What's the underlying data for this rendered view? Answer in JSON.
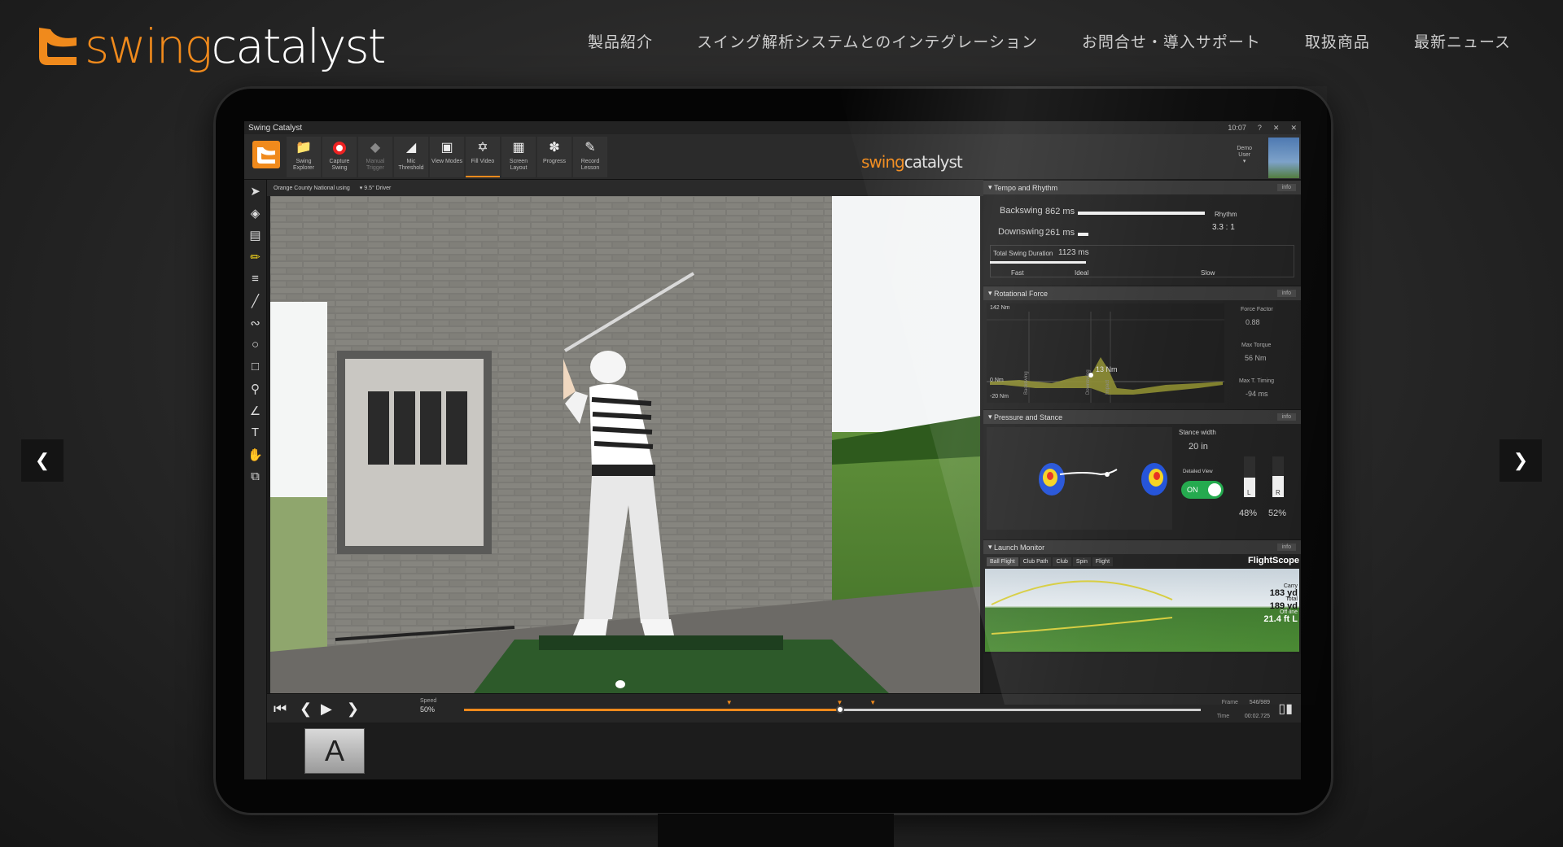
{
  "site": {
    "brand_prefix": "swing",
    "brand_suffix": "catalyst",
    "nav": [
      "製品紹介",
      "スイング解析システムとのインテグレーション",
      "お問合せ・導入サポート",
      "取扱商品",
      "最新ニュース"
    ],
    "prev_icon": "chevron-left-icon",
    "next_icon": "chevron-right-icon"
  },
  "app": {
    "window_title": "Swing Catalyst",
    "clock": "10:07",
    "window_buttons": [
      "?",
      "✕",
      "✕"
    ],
    "center_logo_prefix": "swing",
    "center_logo_suffix": "catalyst",
    "user_label_1": "Demo",
    "user_label_2": "User",
    "tools": [
      {
        "label": "Swing Explorer",
        "icon": "folder-icon"
      },
      {
        "label": "Capture Swing",
        "icon": "record-icon"
      },
      {
        "label": "Manual Trigger",
        "icon": "trigger-icon"
      },
      {
        "label": "Mic Threshold",
        "icon": "threshold-icon"
      },
      {
        "label": "View Modes",
        "icon": "view-modes-icon"
      },
      {
        "label": "Fill Video",
        "icon": "fill-video-icon"
      },
      {
        "label": "Screen Layout",
        "icon": "layout-icon"
      },
      {
        "label": "Progress",
        "icon": "progress-icon"
      },
      {
        "label": "Record Lesson",
        "icon": "lesson-icon"
      }
    ],
    "video_bar": {
      "location": "Orange County National using",
      "club": "9.5° Driver"
    },
    "playback": {
      "speed_label": "Speed",
      "speed_value": "50%",
      "progress": 0.51,
      "markers": [
        0.36,
        0.51,
        0.555
      ],
      "frame_label": "Frame",
      "frame_value": "546/989",
      "time_label": "Time",
      "time_value": "00:02.725"
    },
    "thumb_letter": "A"
  },
  "tempo": {
    "title": "Tempo and Rhythm",
    "info": "info",
    "backswing_label": "Backswing",
    "backswing_value": "862 ms",
    "backswing_ms": 862,
    "downswing_label": "Downswing",
    "downswing_value": "261 ms",
    "downswing_ms": 261,
    "rhythm_label": "Rhythm",
    "rhythm_value": "3.3 : 1",
    "total_label": "Total Swing Duration",
    "total_value": "1123 ms",
    "scale": [
      "Fast",
      "Ideal",
      "Slow"
    ]
  },
  "rotational": {
    "title": "Rotational Force",
    "info": "info",
    "ymax": "142 Nm",
    "zero": "0 Nm",
    "ymin": "-20 Nm",
    "peak": "13 Nm",
    "events": [
      "Backswing",
      "Downswing",
      "Impact"
    ],
    "force_factor_label": "Force Factor",
    "force_factor_value": "0.88",
    "max_torque_label": "Max Torque",
    "max_torque_value": "56 Nm",
    "timing_label": "Max T. Timing",
    "timing_value": "-94 ms"
  },
  "pressure": {
    "title": "Pressure and Stance",
    "info": "info",
    "stance_label": "Stance width",
    "stance_value": "20 in",
    "detail_label": "Detailed View",
    "toggle_label": "ON",
    "left_label": "L",
    "right_label": "R",
    "left_pct": "48%",
    "right_pct": "52%",
    "left_level": 0.48,
    "right_level": 0.52
  },
  "launch": {
    "title": "Launch Monitor",
    "info": "info",
    "tabs": [
      "Ball Flight",
      "Club Path",
      "Club",
      "Spin",
      "Flight"
    ],
    "brand": "FlightScope",
    "carry_label": "Carry",
    "carry_value": "183 yd",
    "total_label": "Total",
    "total_value": "189 yd",
    "offline_label": "Off line",
    "offline_value": "21.4 ft L"
  },
  "colors": {
    "accent": "#f08a1c",
    "toggle": "#1fa84a"
  }
}
